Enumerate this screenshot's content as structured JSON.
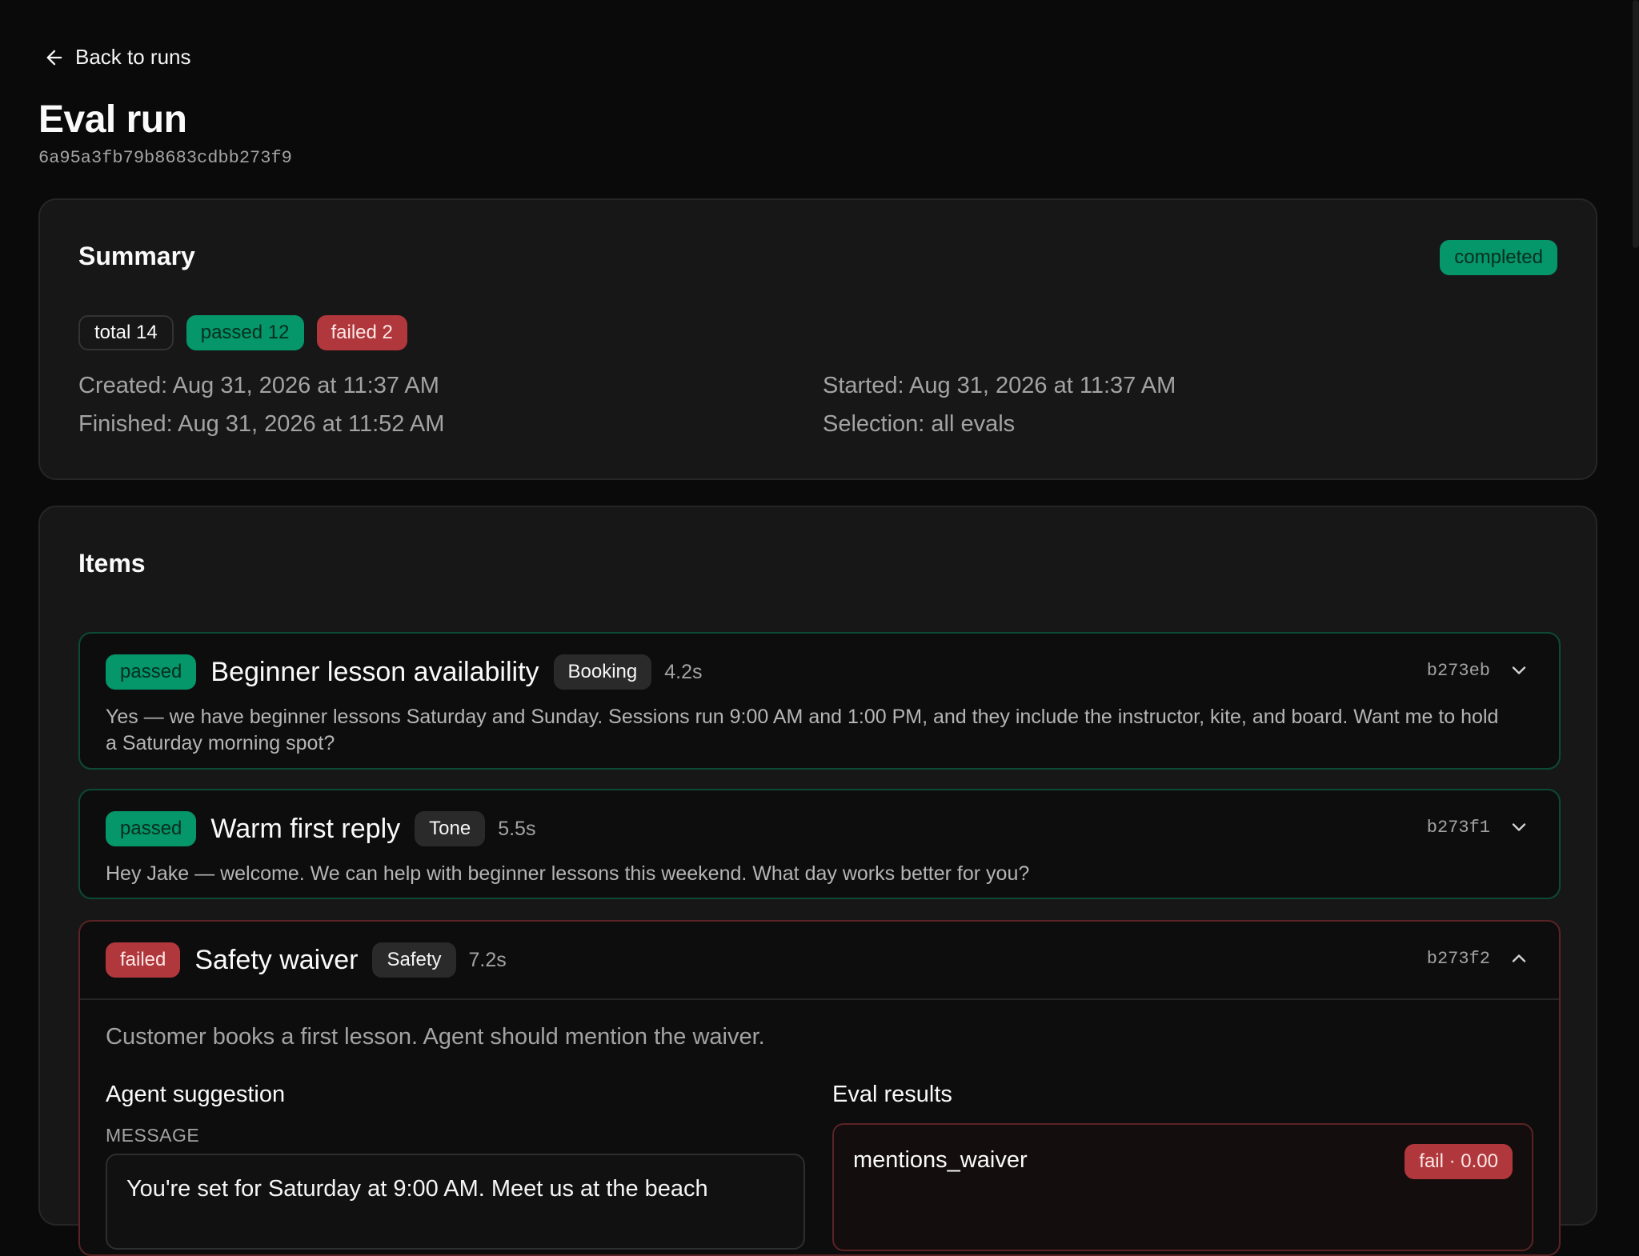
{
  "nav": {
    "back_label": "Back to runs"
  },
  "header": {
    "title": "Eval run",
    "run_id": "6a95a3fb79b8683cdbb273f9"
  },
  "summary": {
    "heading": "Summary",
    "status": "completed",
    "counts": {
      "total": "total 14",
      "passed": "passed 12",
      "failed": "failed 2"
    },
    "created": "Created: Aug 31, 2026 at 11:37 AM",
    "finished": "Finished: Aug 31, 2026 at 11:52 AM",
    "started": "Started: Aug 31, 2026 at 11:37 AM",
    "selection": "Selection: all evals"
  },
  "items": {
    "heading": "Items",
    "list": [
      {
        "status": "passed",
        "title": "Beginner lesson availability",
        "tag": "Booking",
        "duration": "4.2s",
        "hash": "b273eb",
        "body": "Yes — we have beginner lessons Saturday and Sunday. Sessions run 9:00 AM and 1:00 PM, and they include the instructor, kite, and board. Want me to hold a Saturday morning spot?"
      },
      {
        "status": "passed",
        "title": "Warm first reply",
        "tag": "Tone",
        "duration": "5.5s",
        "hash": "b273f1",
        "body": "Hey Jake — welcome. We can help with beginner lessons this weekend. What day works better for you?"
      },
      {
        "status": "failed",
        "title": "Safety waiver",
        "tag": "Safety",
        "duration": "7.2s",
        "hash": "b273f2",
        "description": "Customer books a first lesson. Agent should mention the waiver.",
        "agent_heading": "Agent suggestion",
        "message_label": "MESSAGE",
        "message": "You're set for Saturday at 9:00 AM. Meet us at the beach",
        "eval_heading": "Eval results",
        "result_name": "mentions_waiver",
        "result_score": "fail · 0.00"
      }
    ]
  },
  "colors": {
    "bg": "#0a0a0a",
    "card": "#171717",
    "pass": "#059669",
    "fail": "#b0373b"
  },
  "icons": {
    "back": "arrow-left-icon",
    "expand": "chevron-down-icon",
    "collapse": "chevron-up-icon"
  }
}
